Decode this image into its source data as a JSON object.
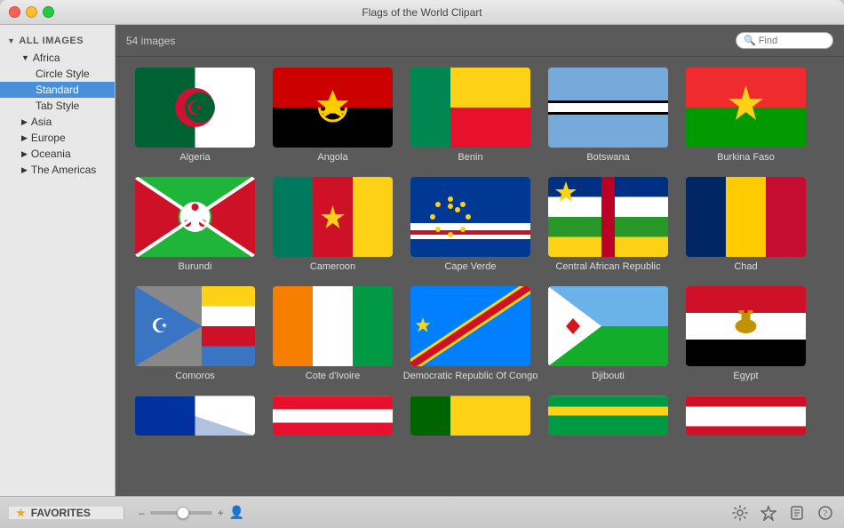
{
  "window": {
    "title": "Flags of the World Clipart"
  },
  "toolbar": {
    "search_placeholder": "Find"
  },
  "sidebar": {
    "all_images_label": "ALL IMAGES",
    "items": [
      {
        "id": "africa",
        "label": "Africa",
        "level": 1,
        "expanded": true,
        "arrow": "▼"
      },
      {
        "id": "circle-style",
        "label": "Circle Style",
        "level": 2
      },
      {
        "id": "standard",
        "label": "Standard",
        "level": 2,
        "selected": true
      },
      {
        "id": "tab-style",
        "label": "Tab Style",
        "level": 2
      },
      {
        "id": "asia",
        "label": "Asia",
        "level": 1,
        "expanded": false,
        "arrow": "▶"
      },
      {
        "id": "europe",
        "label": "Europe",
        "level": 1,
        "expanded": false,
        "arrow": "▶"
      },
      {
        "id": "oceania",
        "label": "Oceania",
        "level": 1,
        "expanded": false,
        "arrow": "▶"
      },
      {
        "id": "the-americas",
        "label": "The Americas",
        "level": 1,
        "expanded": false,
        "arrow": "▶"
      }
    ]
  },
  "content": {
    "image_count": "54 images",
    "flags": [
      {
        "id": "algeria",
        "label": "Algeria"
      },
      {
        "id": "angola",
        "label": "Angola"
      },
      {
        "id": "benin",
        "label": "Benin"
      },
      {
        "id": "botswana",
        "label": "Botswana"
      },
      {
        "id": "burkina-faso",
        "label": "Burkina Faso"
      },
      {
        "id": "burundi",
        "label": "Burundi"
      },
      {
        "id": "cameroon",
        "label": "Cameroon"
      },
      {
        "id": "cape-verde",
        "label": "Cape Verde"
      },
      {
        "id": "central-african-republic",
        "label": "Central African Republic"
      },
      {
        "id": "chad",
        "label": "Chad"
      },
      {
        "id": "comoros",
        "label": "Comoros"
      },
      {
        "id": "cote-divoire",
        "label": "Cote d'Ivoire"
      },
      {
        "id": "drc",
        "label": "Democratic Republic Of Congo"
      },
      {
        "id": "djibouti",
        "label": "Djibouti"
      },
      {
        "id": "egypt",
        "label": "Egypt"
      }
    ]
  },
  "bottom_bar": {
    "favorites_label": "FAVORITES",
    "icons": [
      "gear",
      "star",
      "script",
      "help"
    ]
  }
}
